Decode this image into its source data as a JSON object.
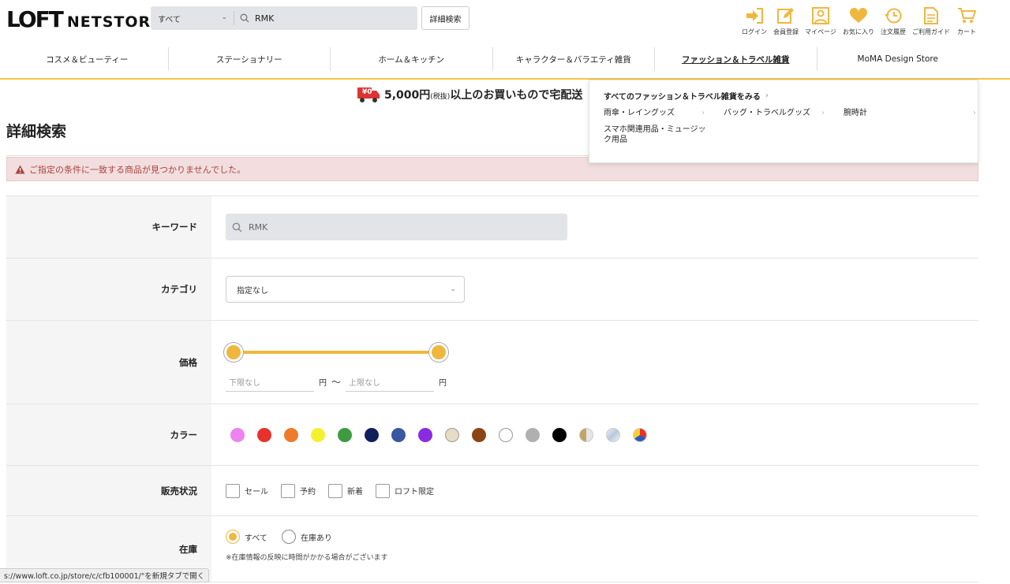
{
  "header": {
    "logo_main": "LOFT",
    "logo_sub": "NETSTORE",
    "search_category": "すべて",
    "search_query": "RMK",
    "advanced_search_label": "詳細検索",
    "util_nav": [
      {
        "label": "ログイン",
        "icon": "login-icon"
      },
      {
        "label": "会員登録",
        "icon": "edit-icon"
      },
      {
        "label": "マイページ",
        "icon": "user-icon"
      },
      {
        "label": "お気に入り",
        "icon": "heart-icon"
      },
      {
        "label": "注文履歴",
        "icon": "history-icon"
      },
      {
        "label": "ご利用ガイド",
        "icon": "guide-icon"
      },
      {
        "label": "カート",
        "icon": "cart-icon"
      }
    ],
    "accent_color": "#f0b73f"
  },
  "category_nav": [
    {
      "label": "コスメ＆ビューティー",
      "active": false
    },
    {
      "label": "ステーショナリー",
      "active": false
    },
    {
      "label": "ホーム＆キッチン",
      "active": false
    },
    {
      "label": "キャラクター＆バラエティ雑貨",
      "active": false
    },
    {
      "label": "ファッション＆トラベル雑貨",
      "active": true
    },
    {
      "label": "MoMA Design Store",
      "active": false
    }
  ],
  "banner": {
    "badge": "¥0",
    "amount": "5,000円",
    "tax": "(税抜)",
    "text": "以上のお買いもので宅配送"
  },
  "dropdown": {
    "all_link": "すべてのファッション＆トラベル雑貨をみる",
    "items": [
      "雨傘・レイングッズ",
      "バッグ・トラベルグッズ",
      "腕時計",
      "スマホ関連用品・ミュージック用品"
    ]
  },
  "page": {
    "title": "詳細検索",
    "alert": "ご指定の条件に一致する商品が見つかりませんでした。"
  },
  "form": {
    "keyword_label": "キーワード",
    "keyword_value": "RMK",
    "category_label": "カテゴリ",
    "category_value": "指定なし",
    "price_label": "価格",
    "price_min_placeholder": "下限なし",
    "price_max_placeholder": "上限なし",
    "yen": "円",
    "tilde": "〜",
    "color_label": "カラー",
    "colors": [
      "#ee82ee",
      "#e8312a",
      "#f07a2b",
      "#f6f12e",
      "#3e9b42",
      "#12205a",
      "#3a57a0",
      "#8a2be2",
      "#e6dcc4",
      "#8b4513",
      "#ffffff",
      "#b0b0b0",
      "#000000",
      "#c2a464",
      "#c7d9ea",
      "multi"
    ],
    "status_label": "販売状況",
    "status_options": [
      "セール",
      "予約",
      "新着",
      "ロフト限定"
    ],
    "stock_label": "在庫",
    "stock_options": [
      {
        "label": "すべて",
        "selected": true
      },
      {
        "label": "在庫あり",
        "selected": false
      }
    ],
    "stock_note": "※在庫情報の反映に時間がかかる場合がございます"
  },
  "status_bar": "s://www.loft.co.jp/store/c/cfb100001/\"を新規タブで開く"
}
